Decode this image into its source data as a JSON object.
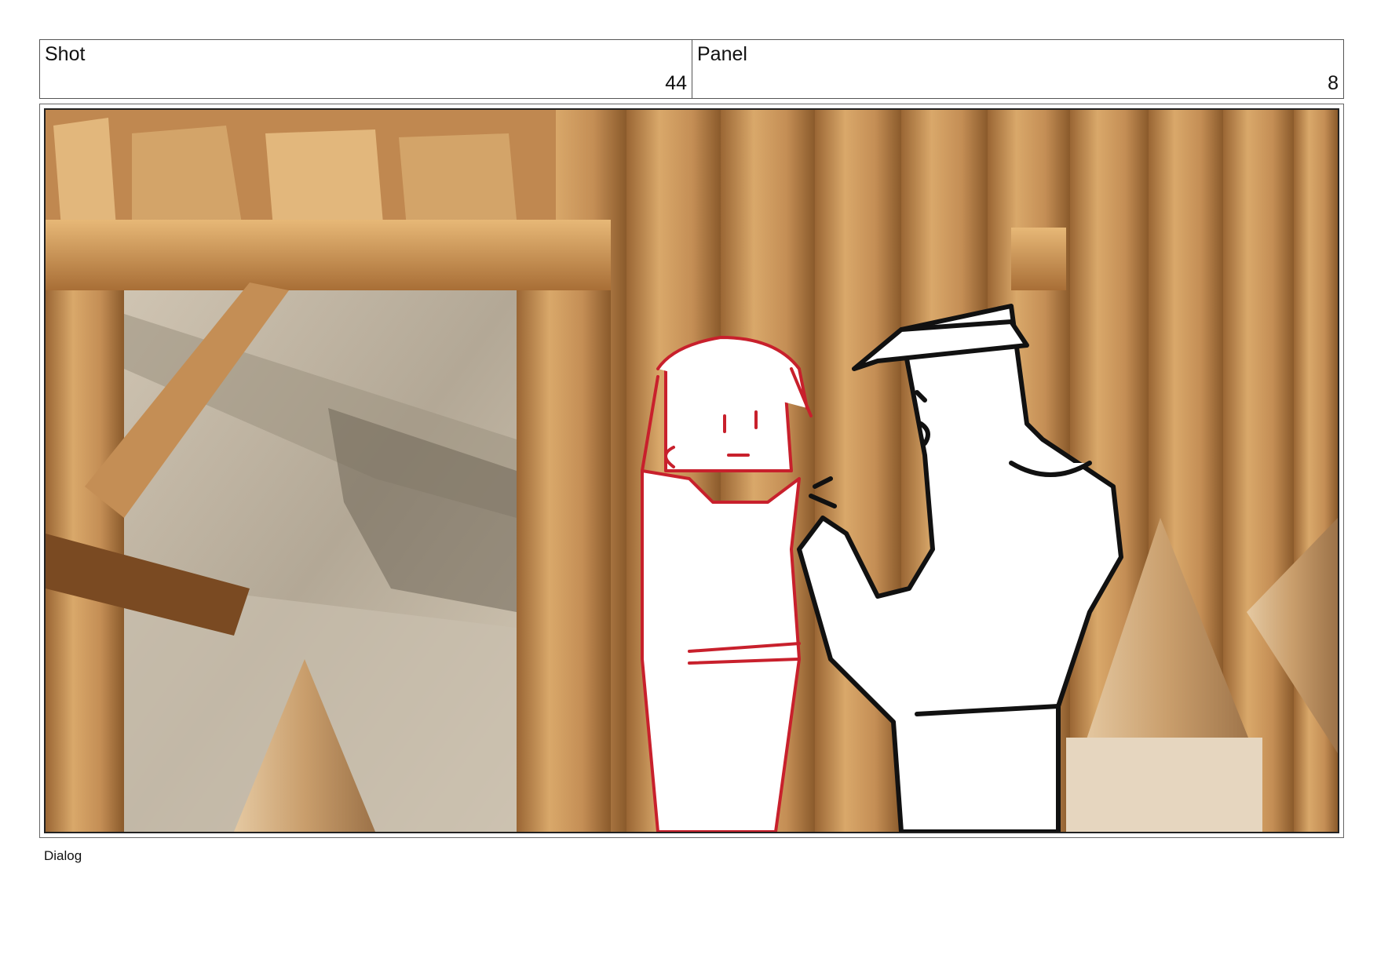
{
  "header": {
    "shot_label": "Shot",
    "shot_value": "44",
    "panel_label": "Panel",
    "panel_value": "8"
  },
  "frame": {
    "description_icons": [
      "wooden-scaffold-icon",
      "rock-wall-icon",
      "log-palisade-icon",
      "girl-sketch-icon",
      "man-in-cap-sketch-icon",
      "wooden-spike-icon"
    ],
    "colors": {
      "wood_dark": "#8a5a2b",
      "wood_mid": "#c08850",
      "wood_light": "#e2b77c",
      "rock": "#b9ad9c",
      "sketch_red": "#c8202c",
      "sketch_black": "#111111"
    }
  },
  "footer": {
    "dialog_label": "Dialog"
  }
}
